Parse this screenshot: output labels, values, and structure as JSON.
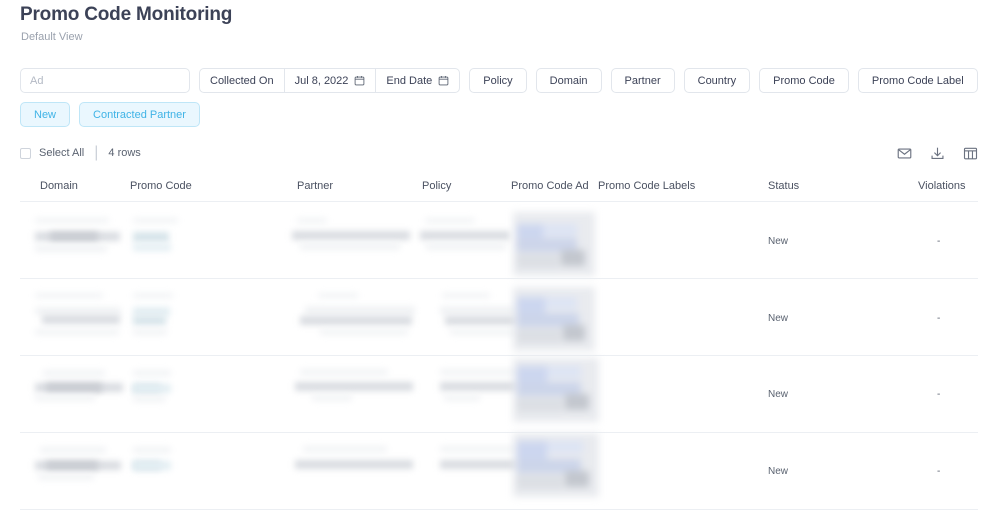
{
  "header": {
    "title": "Promo Code Monitoring",
    "view_label": "Default View"
  },
  "filters": {
    "ad_input": {
      "value": "",
      "placeholder": "Ad"
    },
    "collected_on": {
      "label": "Collected On",
      "value": "Jul 8, 2022",
      "icon": "calendar-icon"
    },
    "end_date": {
      "label": "End Date",
      "value": "",
      "icon": "calendar-icon"
    },
    "chips": [
      {
        "label": "Policy",
        "active": false
      },
      {
        "label": "Domain",
        "active": false
      },
      {
        "label": "Partner",
        "active": false
      },
      {
        "label": "Country",
        "active": false
      },
      {
        "label": "Promo Code",
        "active": false
      },
      {
        "label": "Promo Code Label",
        "active": false
      },
      {
        "label": "New",
        "active": true
      },
      {
        "label": "Contracted Partner",
        "active": true
      }
    ],
    "active_color": "#3fb3e6",
    "active_bg": "#eaf7fe"
  },
  "toolbar": {
    "select_all_label": "Select All",
    "separator": "|",
    "rows_count": "4 rows",
    "icons": [
      {
        "name": "email-icon",
        "label": "Email"
      },
      {
        "name": "download-icon",
        "label": "Download"
      },
      {
        "name": "columns-icon",
        "label": "Columns"
      }
    ]
  },
  "table": {
    "columns": [
      {
        "key": "domain",
        "label": "Domain"
      },
      {
        "key": "promo_code",
        "label": "Promo Code"
      },
      {
        "key": "partner",
        "label": "Partner"
      },
      {
        "key": "policy",
        "label": "Policy"
      },
      {
        "key": "promo_code_ad",
        "label": "Promo Code Ad"
      },
      {
        "key": "promo_code_labels",
        "label": "Promo Code Labels"
      },
      {
        "key": "status",
        "label": "Status"
      },
      {
        "key": "violations",
        "label": "Violations"
      }
    ],
    "rows": [
      {
        "domain": "",
        "promo_code": "",
        "partner": "",
        "policy": "",
        "promo_code_labels": "",
        "status": "New",
        "violations": "-"
      },
      {
        "domain": "",
        "promo_code": "",
        "partner": "",
        "policy": "",
        "promo_code_labels": "",
        "status": "New",
        "violations": "-"
      },
      {
        "domain": "",
        "promo_code": "",
        "partner": "",
        "policy": "",
        "promo_code_labels": "",
        "status": "New",
        "violations": "-"
      },
      {
        "domain": "",
        "promo_code": "",
        "partner": "",
        "policy": "",
        "promo_code_labels": "",
        "status": "New",
        "violations": "-"
      }
    ]
  }
}
